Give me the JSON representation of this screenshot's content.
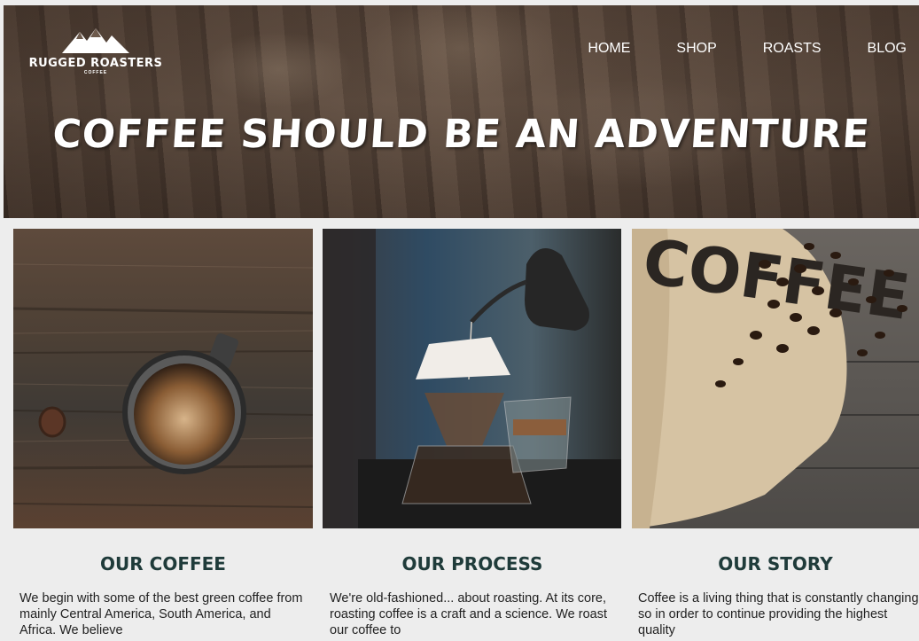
{
  "brand": {
    "name": "RUGGED ROASTERS",
    "sub": "COFFEE"
  },
  "nav": [
    {
      "label": "HOME"
    },
    {
      "label": "SHOP"
    },
    {
      "label": "ROASTS"
    },
    {
      "label": "BLOG"
    }
  ],
  "hero": {
    "headline": "COFFEE SHOULD BE AN ADVENTURE"
  },
  "sections": [
    {
      "title": "OUR COFFEE",
      "text": "We begin with some of the best green coffee from mainly Central America, South America, and Africa. We believe"
    },
    {
      "title": "OUR PROCESS",
      "text": "We're old-fashioned... about roasting. At its core, roasting coffee is a craft and a science. We roast our coffee to"
    },
    {
      "title": "OUR STORY",
      "text": "Coffee is a living thing that is constantly changing so in order to continue providing the highest quality"
    },
    {
      "sack_text": "COFFEE"
    }
  ],
  "colors": {
    "title": "#1f3b3a",
    "background": "#ededed",
    "nav_text": "#ffffff"
  }
}
